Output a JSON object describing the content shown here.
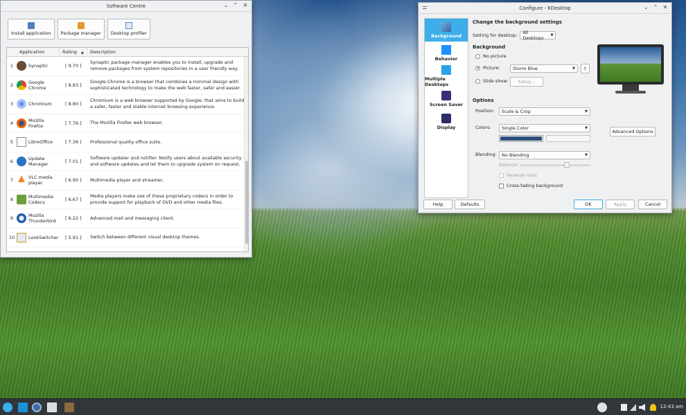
{
  "software_centre": {
    "title": "Software Centre",
    "toolbar": {
      "install": "Install application",
      "package_manager": "Package manager",
      "desktop_profiler": "Desktop profiler"
    },
    "columns": {
      "application": "Application",
      "rating": "Rating",
      "description": "Description"
    },
    "rows": [
      {
        "num": "1",
        "name": "Synaptic",
        "rating": "[ 9.70 ]",
        "desc": "Synaptic package manager enables you to install, upgrade and remove packages from system repositories in a user friendly way."
      },
      {
        "num": "2",
        "name": "Google Chrome",
        "rating": "[ 8.83 ]",
        "desc": "Google Chrome is a browser that combines a minimal design with sophisticated technology to make the web faster, safer and easier."
      },
      {
        "num": "3",
        "name": "Chromium",
        "rating": "[ 8.80 ]",
        "desc": "Chromium is a web browser supported by Google, that aims to build a safer, faster and stable internet browsing experience."
      },
      {
        "num": "4",
        "name": "Mozilla Firefox",
        "rating": "[ 7.76 ]",
        "desc": "The Mozilla Firefox web browser."
      },
      {
        "num": "5",
        "name": "LibreOffice",
        "rating": "[ 7.36 ]",
        "desc": "Professional quality office suite."
      },
      {
        "num": "6",
        "name": "Update Manager",
        "rating": "[ 7.01 ]",
        "desc": "Software updater and notifier. Notify users about available security and software updates and let them to upgrade system on request."
      },
      {
        "num": "7",
        "name": "VLC media player",
        "rating": "[ 6.90 ]",
        "desc": "Multimedia player and streamer."
      },
      {
        "num": "8",
        "name": "Multimedia Codecs",
        "rating": "[ 6.67 ]",
        "desc": "Media players make use of these proprietary codecs in order to provide support for playback of DVD and other media files."
      },
      {
        "num": "9",
        "name": "Mozilla Thunderbird",
        "rating": "[ 6.22 ]",
        "desc": "Advanced mail and messaging client."
      },
      {
        "num": "10",
        "name": "LookSwitcher",
        "rating": "[ 5.91 ]",
        "desc": "Switch between different visual desktop themes."
      }
    ]
  },
  "configure": {
    "title": "Configure - KDesktop",
    "categories": [
      "Background",
      "Behavior",
      "Multiple Desktops",
      "Screen Saver",
      "Display"
    ],
    "heading": "Change the background settings",
    "setting_for_label": "Setting for desktop:",
    "setting_for_value": "All Desktops",
    "background_heading": "Background",
    "no_picture": "No picture",
    "picture_label": "Picture:",
    "picture_value": "Storm Blue",
    "slide_show": "Slide show:",
    "setup_button": "Setup...",
    "options_heading": "Options",
    "position_label": "Position:",
    "position_value": "Scale & Crop",
    "colors_label": "Colors:",
    "colors_value": "Single Color",
    "advanced_options": "Advanced Options",
    "blending_label": "Blending:",
    "blending_value": "No Blending",
    "balance_label": "Balance:",
    "reverse_roles": "Reverse roles",
    "cross_fading": "Cross-fading background",
    "buttons": {
      "help": "Help",
      "defaults": "Defaults",
      "ok": "OK",
      "apply": "Apply",
      "cancel": "Cancel"
    }
  },
  "taskbar": {
    "clock": "12:43 am"
  },
  "colors": {
    "accent": "#3daee9",
    "color_swatch": "#2e4f7a"
  }
}
